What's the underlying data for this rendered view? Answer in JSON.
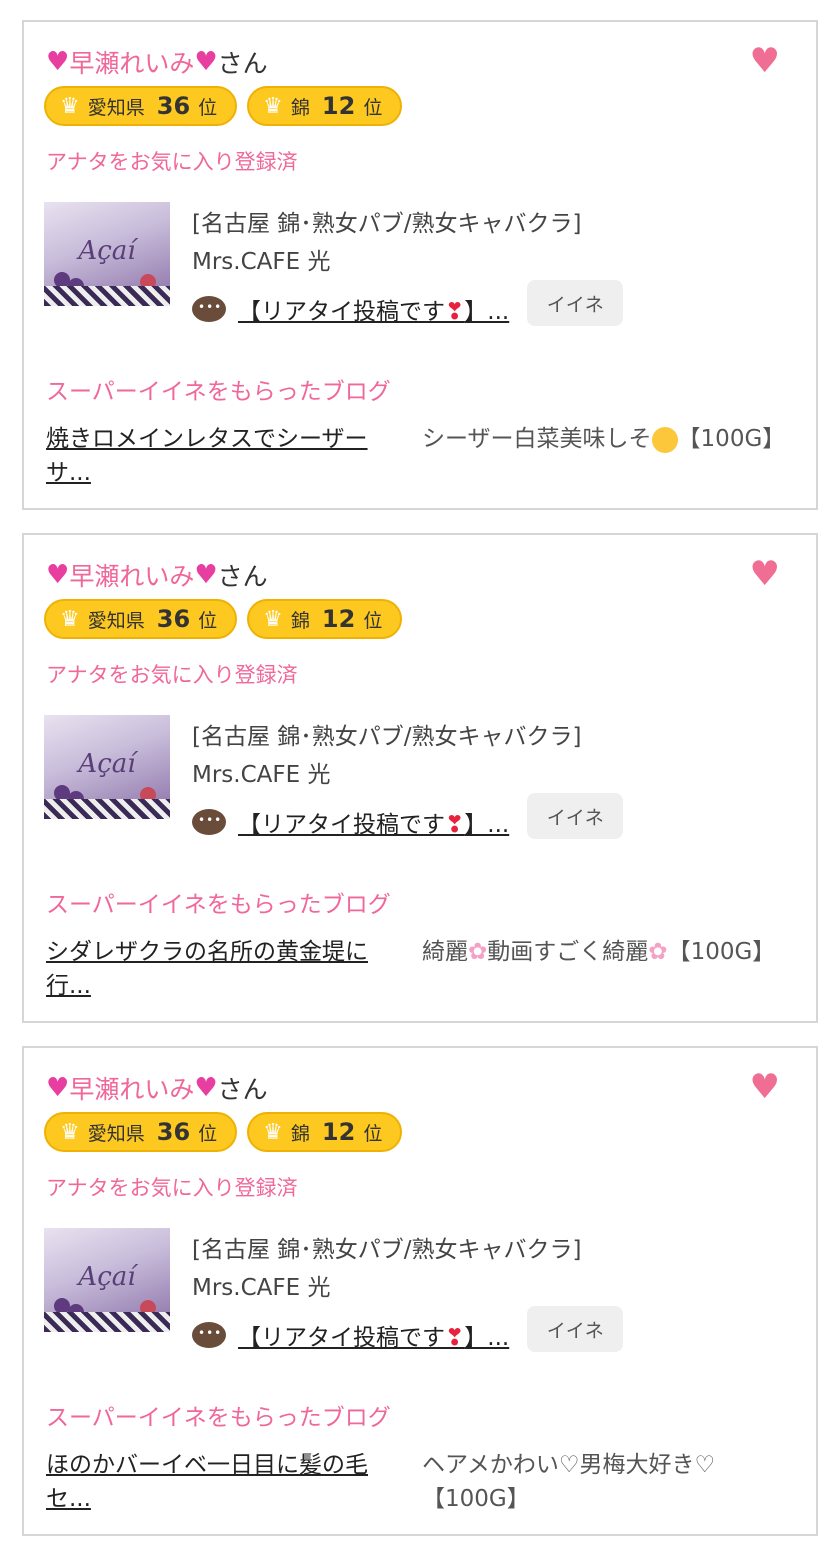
{
  "cards": [
    {
      "user_name": "早瀬れいみ",
      "user_suffix": "さん",
      "badge_pref": "愛知県",
      "badge_pref_rank": "36",
      "badge_area": "錦",
      "badge_area_rank": "12",
      "badge_unit": "位",
      "fav_status": "アナタをお気に入り登録済",
      "shop_category": "[名古屋 錦･熟女パブ/熟女キャバクラ]",
      "shop_name": "Mrs.CAFE 光",
      "post_title_a": "【リアタイ投稿です",
      "post_title_b": "】...",
      "iine_label": "イイネ",
      "blog_heading": "スーパーイイネをもらったブログ",
      "blog_title": "焼きロメインレタスでシーザーサ...",
      "blog_comment_a": "シーザー白菜美味しそ",
      "blog_comment_b": "【100G】",
      "blog_comment_emoji": "face"
    },
    {
      "user_name": "早瀬れいみ",
      "user_suffix": "さん",
      "badge_pref": "愛知県",
      "badge_pref_rank": "36",
      "badge_area": "錦",
      "badge_area_rank": "12",
      "badge_unit": "位",
      "fav_status": "アナタをお気に入り登録済",
      "shop_category": "[名古屋 錦･熟女パブ/熟女キャバクラ]",
      "shop_name": "Mrs.CAFE 光",
      "post_title_a": "【リアタイ投稿です",
      "post_title_b": "】...",
      "iine_label": "イイネ",
      "blog_heading": "スーパーイイネをもらったブログ",
      "blog_title": "シダレザクラの名所の黄金堤に行...",
      "blog_comment_a": "綺麗",
      "blog_comment_mid": "動画すごく綺麗",
      "blog_comment_b": "【100G】",
      "blog_comment_emoji": "flower"
    },
    {
      "user_name": "早瀬れいみ",
      "user_suffix": "さん",
      "badge_pref": "愛知県",
      "badge_pref_rank": "36",
      "badge_area": "錦",
      "badge_area_rank": "12",
      "badge_unit": "位",
      "fav_status": "アナタをお気に入り登録済",
      "shop_category": "[名古屋 錦･熟女パブ/熟女キャバクラ]",
      "shop_name": "Mrs.CAFE 光",
      "post_title_a": "【リアタイ投稿です",
      "post_title_b": "】...",
      "iine_label": "イイネ",
      "blog_heading": "スーパーイイネをもらったブログ",
      "blog_title": "ほのかバーイベ一日目に髪の毛セ...",
      "blog_comment_a": "ヘアメかわい♡男梅大好き♡",
      "blog_comment_b": "【100G】",
      "blog_comment_emoji": "none"
    }
  ],
  "thumbnail_text": "Açaí",
  "colors": {
    "pink": "#f0679a",
    "gold": "#fdc81f",
    "heart": "#f06d93"
  },
  "icons": {
    "favorite": "heart-icon",
    "rank": "crown-icon",
    "comment": "speech-bubble-icon"
  }
}
